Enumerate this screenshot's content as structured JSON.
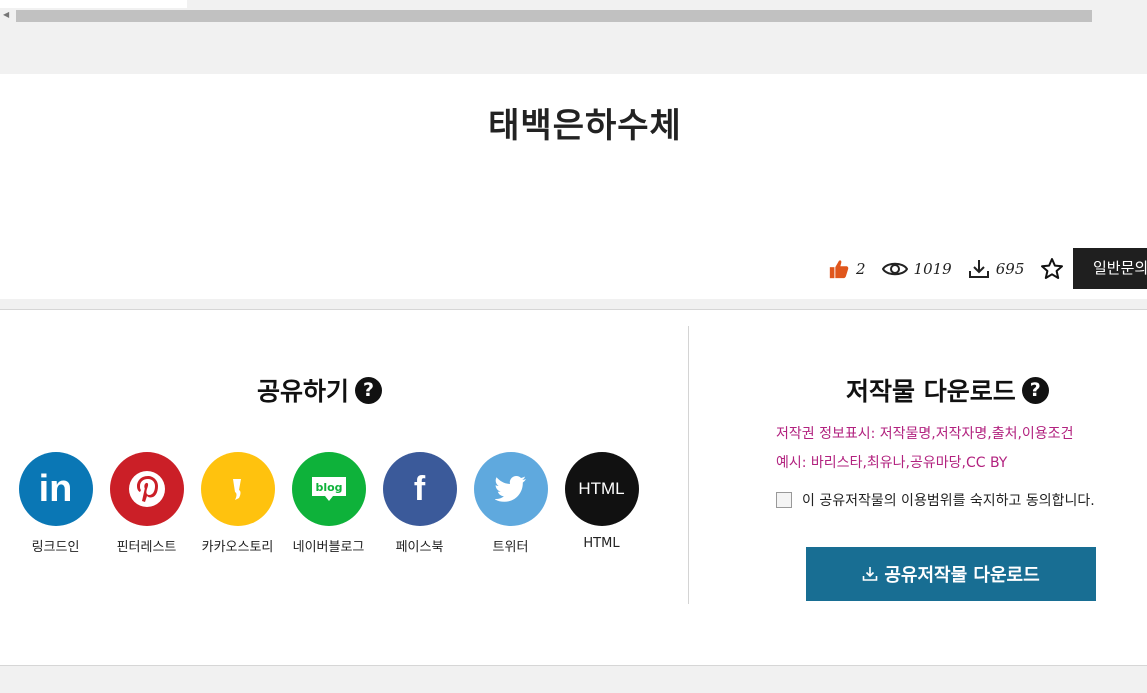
{
  "page": {
    "title": "태백은하수체"
  },
  "stats": {
    "likes": "2",
    "views": "1019",
    "downloads": "695",
    "inquiry_label": "일반문의"
  },
  "share": {
    "title": "공유하기",
    "help": "?",
    "items": [
      {
        "label": "링크드인",
        "icon": "linkedin-icon",
        "color": "#0a77b5",
        "glyph": "in"
      },
      {
        "label": "핀터레스트",
        "icon": "pinterest-icon",
        "color": "#cb1f27",
        "glyph": "P"
      },
      {
        "label": "카카오스토리",
        "icon": "kakaostory-icon",
        "color": "#ffc20e",
        "glyph": ""
      },
      {
        "label": "네이버블로그",
        "icon": "naver-blog-icon",
        "color": "#0eb23a",
        "glyph": "blog"
      },
      {
        "label": "페이스북",
        "icon": "facebook-icon",
        "color": "#3b5a9a",
        "glyph": "f"
      },
      {
        "label": "트위터",
        "icon": "twitter-icon",
        "color": "#5fa9de",
        "glyph": ""
      },
      {
        "label": "HTML",
        "icon": "html-icon",
        "color": "#111111",
        "glyph": "HTML"
      }
    ]
  },
  "download": {
    "title": "저작물 다운로드",
    "help": "?",
    "notice_line1": "저작권 정보표시: 저작물명,저작자명,출처,이용조건",
    "notice_line2": "예시: 바리스타,최유나,공유마당,CC BY",
    "agree_label": "이 공유저작물의 이용범위를 숙지하고 동의합니다.",
    "button_label": "공유저작물 다운로드",
    "accent_color": "#186e93",
    "notice_color": "#b2227f"
  }
}
